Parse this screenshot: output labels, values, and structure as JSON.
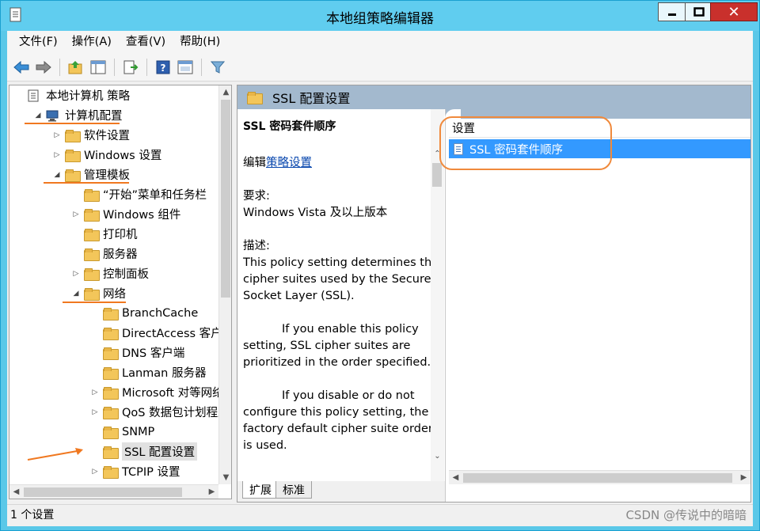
{
  "window": {
    "title": "本地组策略编辑器"
  },
  "menu": [
    "文件(F)",
    "操作(A)",
    "查看(V)",
    "帮助(H)"
  ],
  "tree": [
    {
      "label": "本地计算机 策略",
      "depth": 0,
      "toggle": "",
      "icon": "policy-icon"
    },
    {
      "label": "计算机配置",
      "depth": 1,
      "toggle": "◢",
      "icon": "computer-icon"
    },
    {
      "label": "软件设置",
      "depth": 2,
      "toggle": "▷",
      "icon": "folder-icon"
    },
    {
      "label": "Windows 设置",
      "depth": 2,
      "toggle": "▷",
      "icon": "folder-icon"
    },
    {
      "label": "管理模板",
      "depth": 2,
      "toggle": "◢",
      "icon": "folder-icon"
    },
    {
      "label": "“开始”菜单和任务栏",
      "depth": 3,
      "toggle": "",
      "icon": "folder-icon"
    },
    {
      "label": "Windows 组件",
      "depth": 3,
      "toggle": "▷",
      "icon": "folder-icon"
    },
    {
      "label": "打印机",
      "depth": 3,
      "toggle": "",
      "icon": "folder-icon"
    },
    {
      "label": "服务器",
      "depth": 3,
      "toggle": "",
      "icon": "folder-icon"
    },
    {
      "label": "控制面板",
      "depth": 3,
      "toggle": "▷",
      "icon": "folder-icon"
    },
    {
      "label": "网络",
      "depth": 3,
      "toggle": "◢",
      "icon": "folder-icon"
    },
    {
      "label": "BranchCache",
      "depth": 4,
      "toggle": "",
      "icon": "folder-icon"
    },
    {
      "label": "DirectAccess 客户端",
      "depth": 4,
      "toggle": "",
      "icon": "folder-icon"
    },
    {
      "label": "DNS 客户端",
      "depth": 4,
      "toggle": "",
      "icon": "folder-icon"
    },
    {
      "label": "Lanman 服务器",
      "depth": 4,
      "toggle": "",
      "icon": "folder-icon"
    },
    {
      "label": "Microsoft 对等网络",
      "depth": 4,
      "toggle": "▷",
      "icon": "folder-icon"
    },
    {
      "label": "QoS 数据包计划程序",
      "depth": 4,
      "toggle": "▷",
      "icon": "folder-icon"
    },
    {
      "label": "SNMP",
      "depth": 4,
      "toggle": "",
      "icon": "folder-icon"
    },
    {
      "label": "SSL 配置设置",
      "depth": 4,
      "toggle": "",
      "icon": "folder-icon",
      "selected": true
    },
    {
      "label": "TCPIP 设置",
      "depth": 4,
      "toggle": "▷",
      "icon": "folder-icon"
    }
  ],
  "right": {
    "header": "SSL 配置设置",
    "desc": {
      "heading": "SSL 密码套件顺序",
      "edit_prefix": "编辑",
      "edit_link": "策略设置",
      "req_label": "要求:",
      "req_value": "Windows Vista 及以上版本",
      "desc_label": "描述:",
      "p1": "This policy setting determines the cipher suites used by the Secure Socket Layer (SSL).",
      "p2": "If you enable this policy setting, SSL cipher suites are prioritized in the order specified.",
      "p3": "If you disable or do not configure this policy setting, the factory default cipher suite order is used."
    },
    "column_header": "设置",
    "items": [
      "SSL 密码套件顺序"
    ],
    "tabs": [
      "扩展",
      "标准"
    ]
  },
  "status": {
    "text": "1 个设置",
    "watermark": "CSDN @传说中的暗暗"
  },
  "colors": {
    "titlebar": "#60cdef",
    "selection": "#3399ff",
    "annotation": "#f08a3c"
  }
}
